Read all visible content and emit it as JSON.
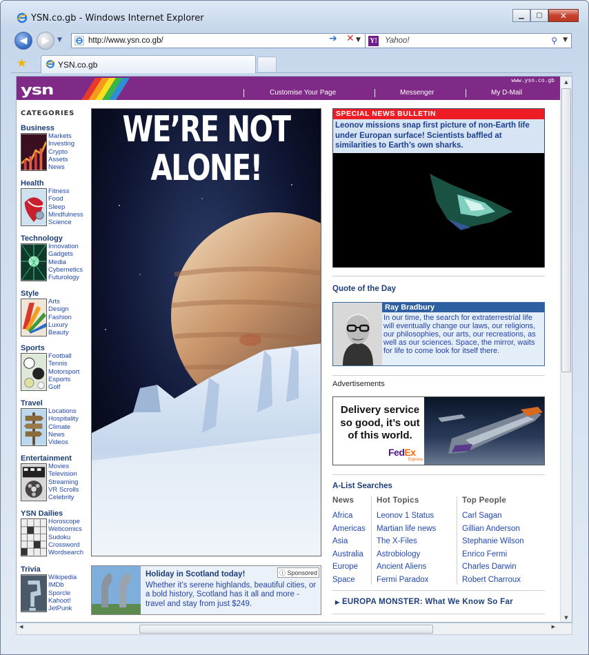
{
  "window": {
    "title": "YSN.co.gb - Windows Internet Explorer",
    "address": "http://www.ysn.co.gb/",
    "search_placeholder": "Yahoo!",
    "tab_label": "YSN.co.gb"
  },
  "header": {
    "logo": "ysn",
    "domain": "www.ysn.co.gb",
    "nav": [
      "Customise Your Page",
      "Messenger",
      "My D-Mail"
    ],
    "brand_color": "#7f2a86"
  },
  "categories": {
    "title": "CATEGORIES",
    "groups": [
      {
        "name": "Business",
        "links": [
          "Markets",
          "Investing",
          "Crypto",
          "Assets",
          "News"
        ]
      },
      {
        "name": "Health",
        "links": [
          "Fitness",
          "Food",
          "Sleep",
          "Mindfulness",
          "Science"
        ]
      },
      {
        "name": "Technology",
        "links": [
          "Innovation",
          "Gadgets",
          "Media",
          "Cybernetics",
          "Futurology"
        ]
      },
      {
        "name": "Style",
        "links": [
          "Arts",
          "Design",
          "Fashion",
          "Luxury",
          "Beauty"
        ]
      },
      {
        "name": "Sports",
        "links": [
          "Football",
          "Tennis",
          "Motorsport",
          "Esports",
          "Golf"
        ]
      },
      {
        "name": "Travel",
        "links": [
          "Locations",
          "Hospitality",
          "Climate",
          "News",
          "Videos"
        ]
      },
      {
        "name": "Entertainment",
        "links": [
          "Movies",
          "Television",
          "Streaming",
          "VR Scrolls",
          "Celebrity"
        ]
      },
      {
        "name": "YSN Dailies",
        "links": [
          "Horoscope",
          "Webcomics",
          "Sudoku",
          "Crossword",
          "Wordsearch"
        ]
      },
      {
        "name": "Trivia",
        "links": [
          "Wikipedia",
          "IMDb",
          "Sporcle",
          "Kahoot!",
          "JetPunk"
        ]
      }
    ]
  },
  "hero": {
    "headline_line1": "WE’RE NOT",
    "headline_line2": "ALONE!"
  },
  "promo": {
    "sponsored": "ⓘ Sponsored",
    "title": "Holiday in Scotland today!",
    "text": "Whether it’s serene highlands, beautiful cities, or a bold history, Scotland has it all and more - travel and stay from just $249."
  },
  "bulletin": {
    "label": "SPECIAL NEWS BULLETIN",
    "text": "Leonov missions snap first picture of non-Earth life under Europan surface! Scientists baffled at similarities to Earth’s own sharks."
  },
  "quote": {
    "title": "Quote of the Day",
    "author": "Ray Bradbury",
    "text": "In our time, the search for extraterrestrial life will eventually change our laws, our religions, our philosophies, our arts, our recreations, as well as our sciences. Space, the mirror, waits for life to come look for itself there."
  },
  "ads": {
    "label": "Advertisements",
    "text": "Delivery service so good, it’s out of this world.",
    "brand_fed": "Fed",
    "brand_ex": "Ex",
    "brand_sub": "Express"
  },
  "alist": {
    "title": "A-List Searches",
    "columns": [
      {
        "head": "News",
        "items": [
          "Africa",
          "Americas",
          "Asia",
          "Australia",
          "Europe",
          "Space"
        ]
      },
      {
        "head": "Hot Topics",
        "items": [
          "Leonov 1 Status",
          "Martian life news",
          "The X-Files",
          "Astrobiology",
          "Ancient Aliens",
          "Fermi Paradox"
        ]
      },
      {
        "head": "Top People",
        "items": [
          "Carl Sagan",
          "Gillian Anderson",
          "Stephanie Wilson",
          "Enrico Fermi",
          "Charles Darwin",
          "Robert Charroux"
        ]
      }
    ],
    "footer_link": "EUROPA MONSTER: What We Know So Far"
  }
}
